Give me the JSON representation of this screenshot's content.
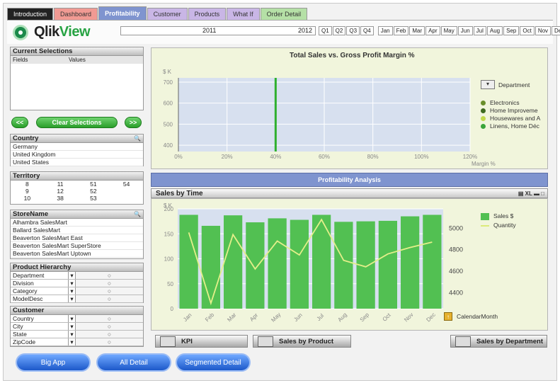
{
  "tabs": [
    {
      "label": "Introduction",
      "bg": "#222222",
      "fg": "#ffffff"
    },
    {
      "label": "Dashboard",
      "bg": "#f19a93",
      "fg": "#333333"
    },
    {
      "label": "Profitability",
      "bg": "#7f94cf",
      "fg": "#ffffff"
    },
    {
      "label": "Customer",
      "bg": "#c9b6e6",
      "fg": "#333333"
    },
    {
      "label": "Products",
      "bg": "#c9b6e6",
      "fg": "#333333"
    },
    {
      "label": "What If",
      "bg": "#c9b6e6",
      "fg": "#333333"
    },
    {
      "label": "Order Detail",
      "bg": "#b5e0a6",
      "fg": "#333333"
    }
  ],
  "app": {
    "qlik": "Qlik",
    "view": "View"
  },
  "years": [
    "2011",
    "2012"
  ],
  "quarters": [
    "Q1",
    "Q2",
    "Q3",
    "Q4"
  ],
  "months": [
    "Jan",
    "Feb",
    "Mar",
    "Apr",
    "May",
    "Jun",
    "Jul",
    "Aug",
    "Sep",
    "Oct",
    "Nov",
    "Dec"
  ],
  "current_selections": {
    "title": "Current Selections",
    "col_fields": "Fields",
    "col_values": "Values"
  },
  "buttons": {
    "prev": "<<",
    "clear": "Clear Selections",
    "next": ">>"
  },
  "country": {
    "title": "Country",
    "items": [
      "Germany",
      "United Kingdom",
      "United States"
    ]
  },
  "territory": {
    "title": "Territory",
    "cells": [
      [
        "8",
        "11",
        "51",
        "54"
      ],
      [
        "9",
        "12",
        "52",
        ""
      ],
      [
        "10",
        "38",
        "53",
        ""
      ]
    ]
  },
  "storename": {
    "title": "StoreName",
    "items": [
      "Alhambra SalesMart",
      "Ballard SalesMart",
      "Beaverton SalesMart East",
      "Beaverton SalesMart SuperStore",
      "Beaverton SalesMart Uptown"
    ]
  },
  "product_hierarchy": {
    "title": "Product Hierarchy",
    "items": [
      "Department",
      "Division",
      "Category",
      "ModelDesc"
    ]
  },
  "customer": {
    "title": "Customer",
    "items": [
      "Country",
      "City",
      "State",
      "ZipCode"
    ]
  },
  "bottom_buttons": [
    "Big App",
    "All Detail",
    "Segmented Detail"
  ],
  "chart1": {
    "title": "Total Sales vs. Gross Profit Margin %",
    "ylabel": "$ K",
    "xlabel": "Margin %",
    "legend_title": "Department",
    "legend_items": [
      "Electronics",
      "Home Improveme",
      "Housewares and A",
      "Linens, Home Déc"
    ],
    "legend_colors": [
      "#6a8f2a",
      "#3e6b1f",
      "#c2d94a",
      "#3aa43a"
    ]
  },
  "section_title": "Profitability Analysis",
  "chart2": {
    "title": "Sales by Time",
    "ylabel": "$ K",
    "legend_sales": "Sales $",
    "legend_qty": "Quantity",
    "legend_dim": "CalendarMonth"
  },
  "nav_buttons": [
    "KPI",
    "Sales by Product",
    "Sales by Department"
  ],
  "chart_data": [
    {
      "type": "scatter",
      "title": "Total Sales vs. Gross Profit Margin %",
      "ylabel": "$ K",
      "xlabel": "Margin %",
      "x_ticks": [
        "0%",
        "20%",
        "40%",
        "60%",
        "80%",
        "100%",
        "120%"
      ],
      "y_ticks": [
        "400",
        "500",
        "600",
        "700"
      ],
      "xlim": [
        0,
        1.2
      ],
      "ylim": [
        370,
        720
      ],
      "series": [
        {
          "name": "",
          "x": [
            0.4,
            0.4
          ],
          "y": [
            370,
            720
          ]
        }
      ]
    },
    {
      "type": "bar",
      "title": "Sales by Time",
      "ylabel": "$ K",
      "categories": [
        "Jan",
        "Feb",
        "Mar",
        "Apr",
        "May",
        "Jun",
        "Jul",
        "Aug",
        "Sep",
        "Oct",
        "Nov",
        "Dec"
      ],
      "ylim": [
        0,
        200
      ],
      "y_ticks": [
        "0",
        "50",
        "100",
        "150",
        "200"
      ],
      "y2_ticks": [
        "4400",
        "4600",
        "4800",
        "5000"
      ],
      "y2lim": [
        4250,
        5180
      ],
      "series": [
        {
          "name": "Sales $",
          "values": [
            188,
            166,
            187,
            173,
            181,
            178,
            188,
            174,
            175,
            176,
            185,
            188
          ]
        },
        {
          "name": "Quantity",
          "axis": "right",
          "values": [
            4960,
            4300,
            4940,
            4620,
            4880,
            4750,
            5080,
            4700,
            4640,
            4760,
            4820,
            4870
          ]
        }
      ]
    }
  ]
}
